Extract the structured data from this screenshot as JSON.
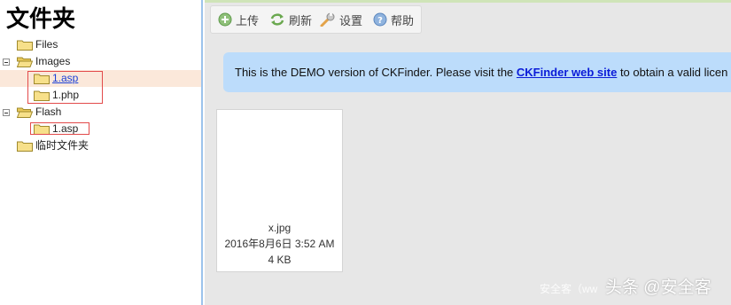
{
  "panel": {
    "title": "文件夹"
  },
  "tree": {
    "files": "Files",
    "images": "Images",
    "images_1asp": "1.asp",
    "images_1php": "1.php",
    "flash": "Flash",
    "flash_1asp": "1.asp",
    "temp": "临时文件夹"
  },
  "toolbar": {
    "upload": "上传",
    "refresh": "刷新",
    "settings": "设置",
    "help": "帮助"
  },
  "notice": {
    "before": "This is the DEMO version of CKFinder. Please visit the ",
    "link": "CKFinder web site",
    "after": " to obtain a valid licen"
  },
  "file": {
    "name": "x.jpg",
    "date": "2016年8月6日 3:52 AM",
    "size": "4 KB"
  },
  "watermark": {
    "faint": "安全客（ww",
    "main": "头条 @安全客"
  },
  "colors": {
    "panel_border": "#9cc3ec",
    "selected_row": "#fbe8da",
    "notice_bg": "#bcdcfb",
    "link": "#0a1bd8",
    "highlight_box": "#e24a4a"
  }
}
